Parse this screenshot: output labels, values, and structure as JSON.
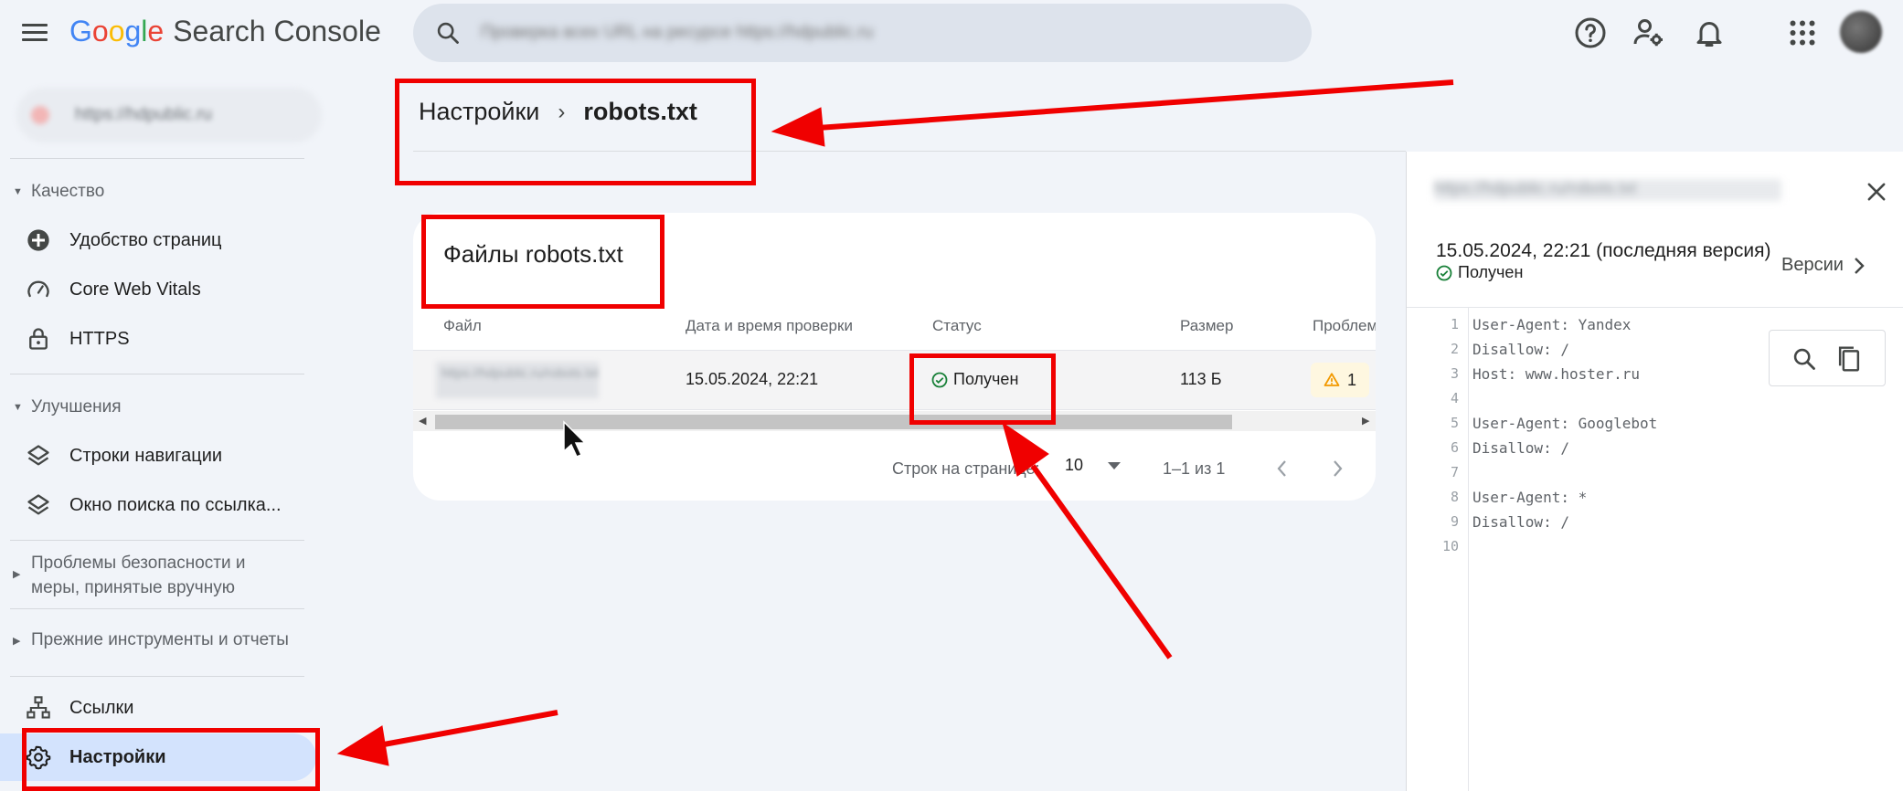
{
  "header": {
    "logo_letters": [
      "G",
      "o",
      "o",
      "g",
      "l",
      "e"
    ],
    "logo_colors": [
      "#4285f4",
      "#ea4335",
      "#fbbc05",
      "#4285f4",
      "#34a853",
      "#ea4335"
    ],
    "product_name": "Search Console",
    "search_placeholder": "Проверка всех URL на ресурсе https://hdpublic.ru",
    "icons": [
      "help-icon",
      "manage-users-icon",
      "notifications-icon",
      "apps-icon"
    ]
  },
  "sidebar": {
    "property": "https://hdpublic.ru",
    "sections": {
      "quality": "Качество",
      "enhancements": "Улучшения",
      "security_line1": "Проблемы безопасности и",
      "security_line2": "меры, принятые вручную",
      "legacy": "Прежние инструменты и отчеты"
    },
    "items": {
      "page_experience": "Удобство страниц",
      "core_web_vitals": "Core Web Vitals",
      "https": "HTTPS",
      "breadcrumbs": "Строки навигации",
      "sitelinks_search": "Окно поиска по ссылка...",
      "links": "Ссылки",
      "settings": "Настройки"
    }
  },
  "breadcrumb": {
    "parent": "Настройки",
    "separator": "›",
    "current": "robots.txt"
  },
  "card": {
    "title": "Файлы robots.txt",
    "columns": {
      "file": "Файл",
      "checked": "Дата и время проверки",
      "status": "Статус",
      "size": "Размер",
      "problems": "Проблем"
    },
    "row": {
      "file": "https://hdpublic.ru/robots.txt",
      "checked": "15.05.2024, 22:21",
      "status": "Получен",
      "size": "113 Б",
      "problems": "1"
    },
    "pagination": {
      "rows_label": "Строк на странице:",
      "rows_value": "10",
      "range": "1–1 из 1"
    }
  },
  "side_panel": {
    "url": "https://hdpublic.ru/robots.txt",
    "date": "15.05.2024, 22:21 (последняя версия)",
    "status": "Получен",
    "versions_label": "Версии",
    "code_lines": [
      {
        "n": "1",
        "text": "User-Agent: Yandex"
      },
      {
        "n": "2",
        "text": "Disallow: /"
      },
      {
        "n": "3",
        "text": "Host: www.hoster.ru"
      },
      {
        "n": "4",
        "text": ""
      },
      {
        "n": "5",
        "text": "User-Agent: Googlebot"
      },
      {
        "n": "6",
        "text": "Disallow: /"
      },
      {
        "n": "7",
        "text": ""
      },
      {
        "n": "8",
        "text": "User-Agent: *"
      },
      {
        "n": "9",
        "text": "Disallow: /"
      },
      {
        "n": "10",
        "text": ""
      }
    ]
  },
  "colors": {
    "accent_red": "#f00000",
    "success_green": "#188038",
    "warning_amber": "#f29900",
    "active_nav": "#d3e3fd"
  }
}
